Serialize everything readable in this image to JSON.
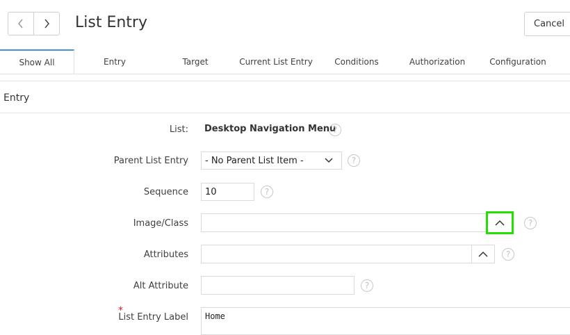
{
  "header": {
    "title": "List Entry",
    "cancel_label": "Cancel",
    "prev_icon": "chevron-left-icon",
    "next_icon": "chevron-right-icon"
  },
  "tabs": [
    {
      "label": "Show All",
      "active": true
    },
    {
      "label": "Entry"
    },
    {
      "label": "Target"
    },
    {
      "label": "Current List Entry"
    },
    {
      "label": "Conditions"
    },
    {
      "label": "Authorization"
    },
    {
      "label": "Configuration"
    }
  ],
  "region": {
    "title": "Entry"
  },
  "form": {
    "list": {
      "label": "List:",
      "value": "Desktop Navigation Menu"
    },
    "parent": {
      "label": "Parent List Entry",
      "value": "- No Parent List Item -"
    },
    "sequence": {
      "label": "Sequence",
      "value": "10"
    },
    "image_class": {
      "label": "Image/Class",
      "value": ""
    },
    "attributes": {
      "label": "Attributes",
      "value": ""
    },
    "alt_attribute": {
      "label": "Alt Attribute",
      "value": ""
    },
    "entry_label": {
      "label": "List Entry Label",
      "value": "Home",
      "required_marker": "*"
    },
    "help_glyph": "?"
  },
  "colors": {
    "focus_highlight": "#22e000",
    "active_tab": "#4a90d9",
    "required": "#e02020"
  }
}
